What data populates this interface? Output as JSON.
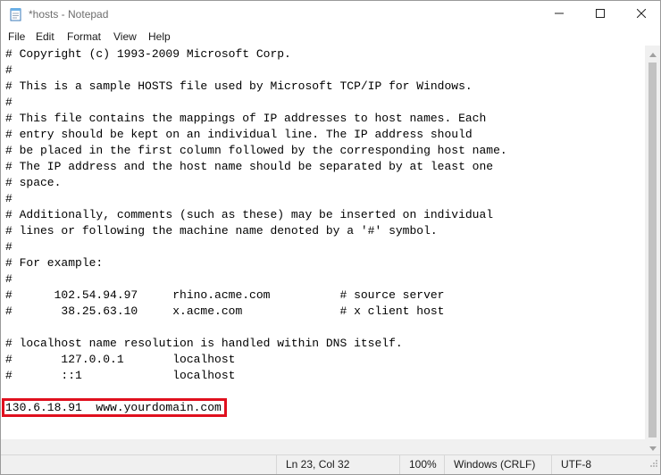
{
  "window": {
    "title": "*hosts - Notepad"
  },
  "menu": [
    "File",
    "Edit",
    "Format",
    "View",
    "Help"
  ],
  "editor": {
    "lines": [
      "# Copyright (c) 1993-2009 Microsoft Corp.",
      "#",
      "# This is a sample HOSTS file used by Microsoft TCP/IP for Windows.",
      "#",
      "# This file contains the mappings of IP addresses to host names. Each",
      "# entry should be kept on an individual line. The IP address should",
      "# be placed in the first column followed by the corresponding host name.",
      "# The IP address and the host name should be separated by at least one",
      "# space.",
      "#",
      "# Additionally, comments (such as these) may be inserted on individual",
      "# lines or following the machine name denoted by a '#' symbol.",
      "#",
      "# For example:",
      "#",
      "#      102.54.94.97     rhino.acme.com          # source server",
      "#       38.25.63.10     x.acme.com              # x client host",
      "",
      "# localhost name resolution is handled within DNS itself.",
      "#\t127.0.0.1       localhost",
      "#\t::1             localhost",
      "",
      "130.6.18.91  www.yourdomain.com"
    ]
  },
  "status": {
    "position": "Ln 23, Col 32",
    "zoom": "100%",
    "line_ending": "Windows (CRLF)",
    "encoding": "UTF-8"
  },
  "colors": {
    "highlight": "#e0101e"
  },
  "icons": {
    "app": "notepad-icon",
    "minimize": "minimize-icon",
    "maximize": "maximize-icon",
    "close": "close-icon"
  }
}
